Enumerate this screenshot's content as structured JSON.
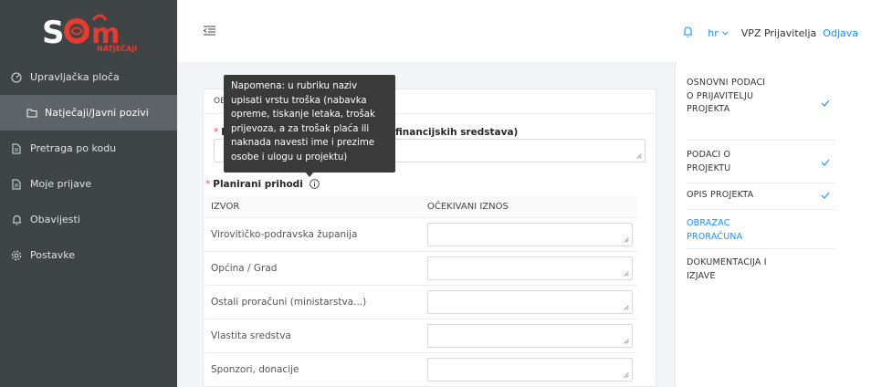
{
  "logo": {
    "wordmark": "S",
    "subtitle": "NATJEČAJI"
  },
  "sidebar": {
    "items": [
      {
        "label": "Upravljačka ploča",
        "icon": "dashboard-icon"
      },
      {
        "label": "Natječaji/Javni pozivi",
        "icon": "folder-icon"
      },
      {
        "label": "Pretraga po kodu",
        "icon": "document-icon"
      },
      {
        "label": "Moje prijave",
        "icon": "document-icon"
      },
      {
        "label": "Obavijesti",
        "icon": "bell-icon"
      },
      {
        "label": "Postavke",
        "icon": "gear-icon"
      }
    ]
  },
  "header": {
    "language": "hr",
    "username": "VPZ Prijavitelja",
    "logout_label": "Odjava"
  },
  "form": {
    "section_title": "OB",
    "field1_label_visible": "N",
    "field1_label_tail": "orisnik financijskih sredstava)",
    "planned_income_label": "Planirani prihodi",
    "table": {
      "col_source": "IZVOR",
      "col_amount": "OČEKIVANI IZNOS",
      "rows": [
        {
          "source": "Virovitičko-podravska županija",
          "amount": ""
        },
        {
          "source": "Općina / Grad",
          "amount": ""
        },
        {
          "source": "Ostali proračuni (ministarstva...)",
          "amount": ""
        },
        {
          "source": "Vlastita sredstva",
          "amount": ""
        },
        {
          "source": "Sponzori, donacije",
          "amount": ""
        }
      ]
    }
  },
  "tooltip": {
    "text": "Napomena: u rubriku naziv upisati vrstu troška (nabavka opreme, tiskanje letaka, trošak prijevoza, a za trošak plaća ili naknada navesti ime i prezime osobe i ulogu u projektu)"
  },
  "steps": [
    {
      "label": "OSNOVNI PODACI O PRIJAVITELJU PROJEKTA",
      "done": true
    },
    {
      "label": "PODACI O PROJEKTU",
      "done": true
    },
    {
      "label": "OPIS PROJEKTA",
      "done": true
    },
    {
      "label": "OBRAZAC PRORAČUNA",
      "done": false,
      "current": true
    },
    {
      "label": "DOKUMENTACIJA I IZJAVE",
      "done": false
    }
  ],
  "colors": {
    "accent": "#1890ff",
    "sidebar": "#3f4447",
    "sidebar_active": "#5d6367",
    "logo_red": "#e63b2e",
    "required": "#ff4d4f",
    "tooltip_bg": "#3a3a3a"
  }
}
